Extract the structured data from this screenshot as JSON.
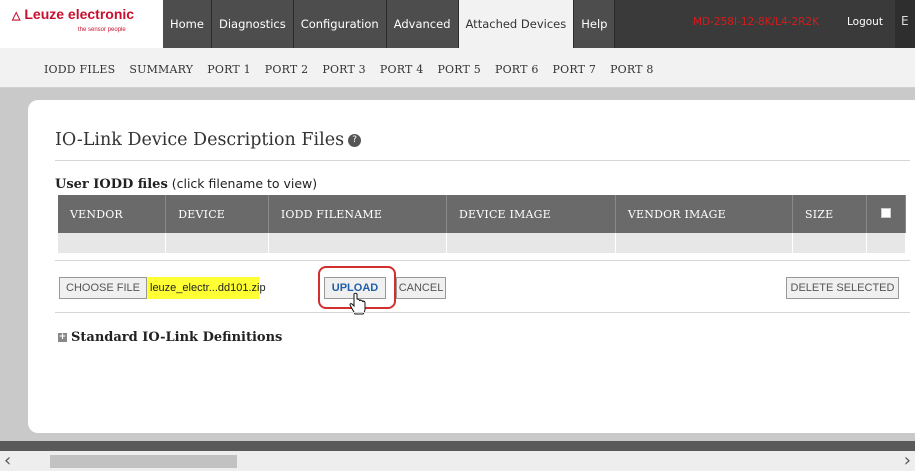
{
  "header": {
    "logo_title": "Leuze electronic",
    "logo_subtitle": "the sensor people",
    "nav": [
      {
        "label": "Home"
      },
      {
        "label": "Diagnostics"
      },
      {
        "label": "Configuration"
      },
      {
        "label": "Advanced"
      },
      {
        "label": "Attached Devices"
      },
      {
        "label": "Help"
      }
    ],
    "active_nav": "Attached Devices",
    "model_text": "MD-258I-12-8K/L4-2R2K",
    "logout_label": "Logout",
    "edge_char": "E"
  },
  "subnav": {
    "items": [
      {
        "label": "IODD FILES"
      },
      {
        "label": "SUMMARY"
      },
      {
        "label": "PORT 1"
      },
      {
        "label": "PORT 2"
      },
      {
        "label": "PORT 3"
      },
      {
        "label": "PORT 4"
      },
      {
        "label": "PORT 5"
      },
      {
        "label": "PORT 6"
      },
      {
        "label": "PORT 7"
      },
      {
        "label": "PORT 8"
      }
    ]
  },
  "main": {
    "title": "IO-Link Device Description Files",
    "table_caption_bold": "User IODD files",
    "table_caption_rest": " (click filename to view)",
    "columns": [
      "VENDOR",
      "DEVICE",
      "IODD FILENAME",
      "DEVICE IMAGE",
      "VENDOR IMAGE",
      "SIZE"
    ],
    "choose_file_label": "CHOOSE FILE",
    "selected_file": "leuze_electr...dd101.zip",
    "upload_label": "UPLOAD",
    "cancel_label": "CANCEL",
    "delete_selected_label": "DELETE SELECTED",
    "standard_defs_label": "Standard IO-Link Definitions"
  },
  "colors": {
    "brand_red": "#c8102e",
    "highlight_yellow": "#ffff33",
    "annotation_red": "#d32f2f"
  }
}
